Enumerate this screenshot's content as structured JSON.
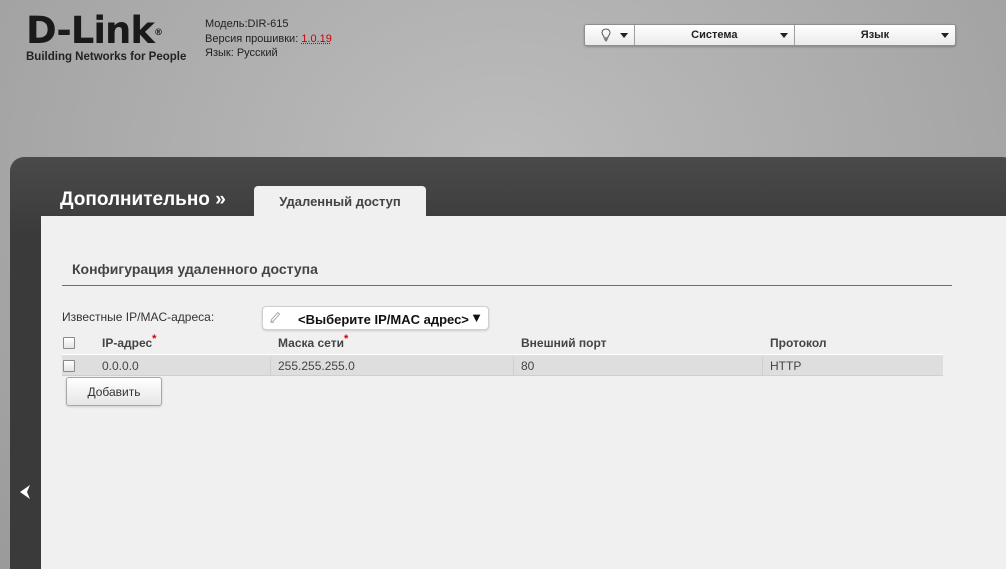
{
  "header": {
    "logo_text": "D-Link",
    "logo_reg": "®",
    "logo_tagline": "Building Networks for People",
    "model": "Модель:DIR-615",
    "firmware_label": "Версия прошивки:",
    "firmware_version": "1.0.19",
    "language_info": "Язык: Русский"
  },
  "topbar": {
    "hint_icon": "lightbulb-icon",
    "system_label": "Система",
    "language_label": "Язык"
  },
  "nav": {
    "breadcrumb": "Дополнительно »",
    "active_tab": "Удаленный доступ"
  },
  "section": {
    "title": "Конфигурация удаленного доступа",
    "known_label": "Известные IP/MAC-адреса:",
    "ipmac_placeholder": "<Выберите IP/MAC адрес>",
    "ipmac_arrow": "▼"
  },
  "table": {
    "columns": [
      "IP-адрес",
      "Маска сети",
      "Внешний порт",
      "Протокол"
    ],
    "required_mark": "*",
    "rows": [
      {
        "ip": "0.0.0.0",
        "mask": "255.255.255.0",
        "port": "80",
        "protocol": "HTTP"
      }
    ]
  },
  "buttons": {
    "add": "Добавить"
  },
  "colors": {
    "accent_red": "#cc0000",
    "panel_dark": "#3a3a3a",
    "content_bg": "#f0f0f0"
  }
}
